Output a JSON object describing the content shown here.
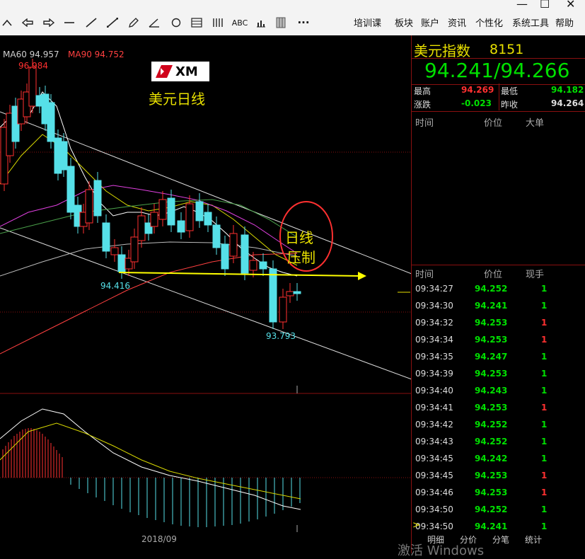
{
  "toolbar": {
    "icons": [
      "up-chevron",
      "left-arrow",
      "right-arrow",
      "dash",
      "line",
      "pencil",
      "wave",
      "circle",
      "grid",
      "bars",
      "ABC",
      "chart-bars",
      "sheet",
      "more"
    ],
    "abc_label": "ABC",
    "more_label": "···",
    "menu": [
      "培训课",
      "板块",
      "账户",
      "资讯",
      "个性化",
      "系统工具",
      "帮助"
    ]
  },
  "chart": {
    "ma60_label": "MA60 94.957",
    "ma90_label": "MA90 94.752",
    "high_label": "96.984",
    "low_label_1": "94.416",
    "low_label_2": "93.793",
    "title": "美元日线",
    "logo_text": "XM",
    "annot_1": "日线",
    "annot_2": "压制",
    "date_label": "2018/09"
  },
  "panel": {
    "title": "美元指数",
    "code": "8151",
    "price": "94.241/94.266",
    "stats": {
      "high_label": "最高",
      "high_val": "94.269",
      "low_label": "最低",
      "low_val": "94.182",
      "change_label": "涨跌",
      "change_val": "-0.023",
      "prev_label": "昨收",
      "prev_val": "94.264"
    },
    "top_headers": [
      "时间",
      "价位",
      "大单"
    ],
    "ticks_headers": [
      "时间",
      "价位",
      "现手"
    ],
    "ticks": [
      {
        "time": "09:34:27",
        "price": "94.252",
        "vol": "1",
        "color": "#00e000"
      },
      {
        "time": "09:34:30",
        "price": "94.241",
        "vol": "1",
        "color": "#00e000"
      },
      {
        "time": "09:34:32",
        "price": "94.253",
        "vol": "1",
        "color": "#ff3030"
      },
      {
        "time": "09:34:34",
        "price": "94.253",
        "vol": "1",
        "color": "#ff3030"
      },
      {
        "time": "09:34:35",
        "price": "94.247",
        "vol": "1",
        "color": "#00e000"
      },
      {
        "time": "09:34:39",
        "price": "94.253",
        "vol": "1",
        "color": "#00e000"
      },
      {
        "time": "09:34:40",
        "price": "94.243",
        "vol": "1",
        "color": "#00e000"
      },
      {
        "time": "09:34:41",
        "price": "94.253",
        "vol": "1",
        "color": "#ff3030"
      },
      {
        "time": "09:34:42",
        "price": "94.252",
        "vol": "1",
        "color": "#00e000"
      },
      {
        "time": "09:34:43",
        "price": "94.252",
        "vol": "1",
        "color": "#00e000"
      },
      {
        "time": "09:34:45",
        "price": "94.242",
        "vol": "1",
        "color": "#00e000"
      },
      {
        "time": "09:34:45",
        "price": "94.253",
        "vol": "1",
        "color": "#ff3030"
      },
      {
        "time": "09:34:46",
        "price": "94.253",
        "vol": "1",
        "color": "#ff3030"
      },
      {
        "time": "09:34:50",
        "price": "94.252",
        "vol": "1",
        "color": "#00e000"
      },
      {
        "time": "09:34:50",
        "price": "94.241",
        "vol": "1",
        "color": "#00e000"
      }
    ],
    "tabs": [
      "明细",
      "分价",
      "分笔",
      "统计"
    ]
  },
  "watermark": "激活 Windows"
}
